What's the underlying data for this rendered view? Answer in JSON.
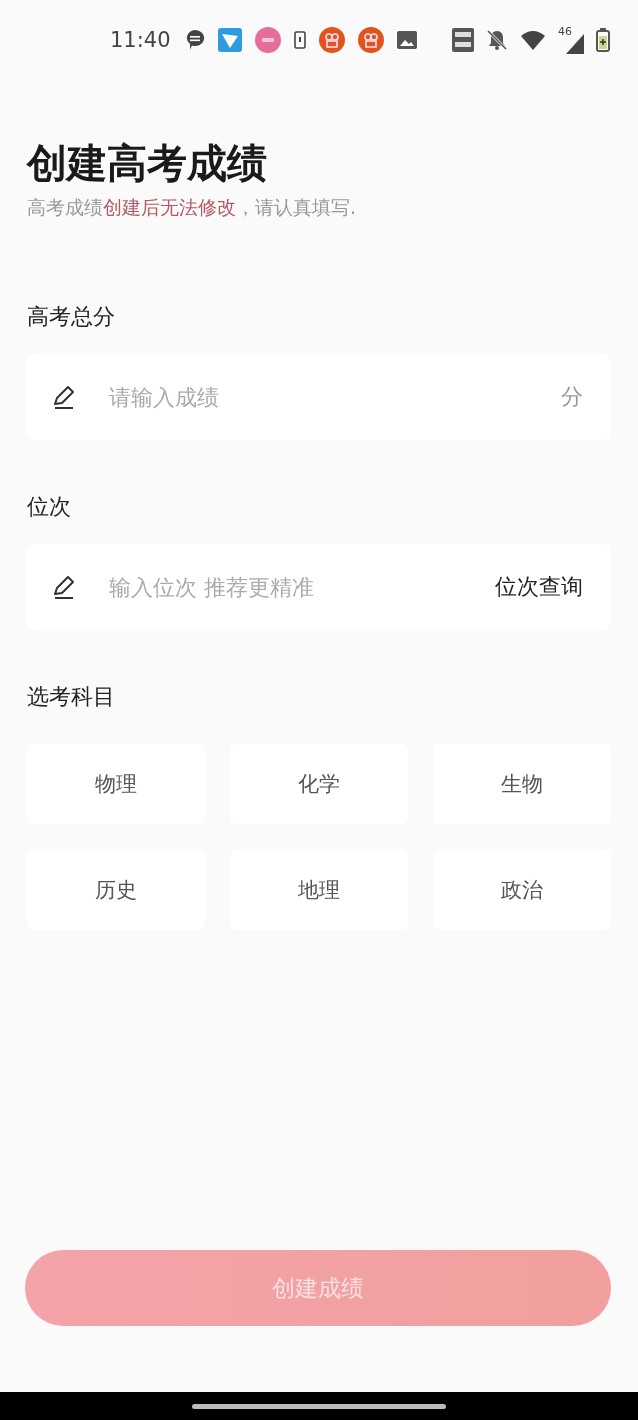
{
  "status_bar": {
    "time": "11:40",
    "network": "46"
  },
  "header": {
    "title": "创建高考成绩",
    "subtitle": "高考成绩**创建后无法修改**，请认真填写."
  },
  "score": {
    "label": "高考总分",
    "placeholder": "请输入成绩",
    "unit": "分"
  },
  "rank": {
    "label": "位次",
    "placeholder": "输入位次 推荐更精准",
    "link": "位次查询"
  },
  "subjects": {
    "label": "选考科目",
    "items": [
      {
        "name": "物理",
        "selected": false
      },
      {
        "name": "化学",
        "selected": false
      },
      {
        "name": "生物",
        "selected": false
      },
      {
        "name": "历史",
        "selected": false
      },
      {
        "name": "地理",
        "selected": false
      },
      {
        "name": "政治",
        "selected": false
      }
    ]
  },
  "submit": {
    "label": "创建成绩",
    "disabled": true
  }
}
